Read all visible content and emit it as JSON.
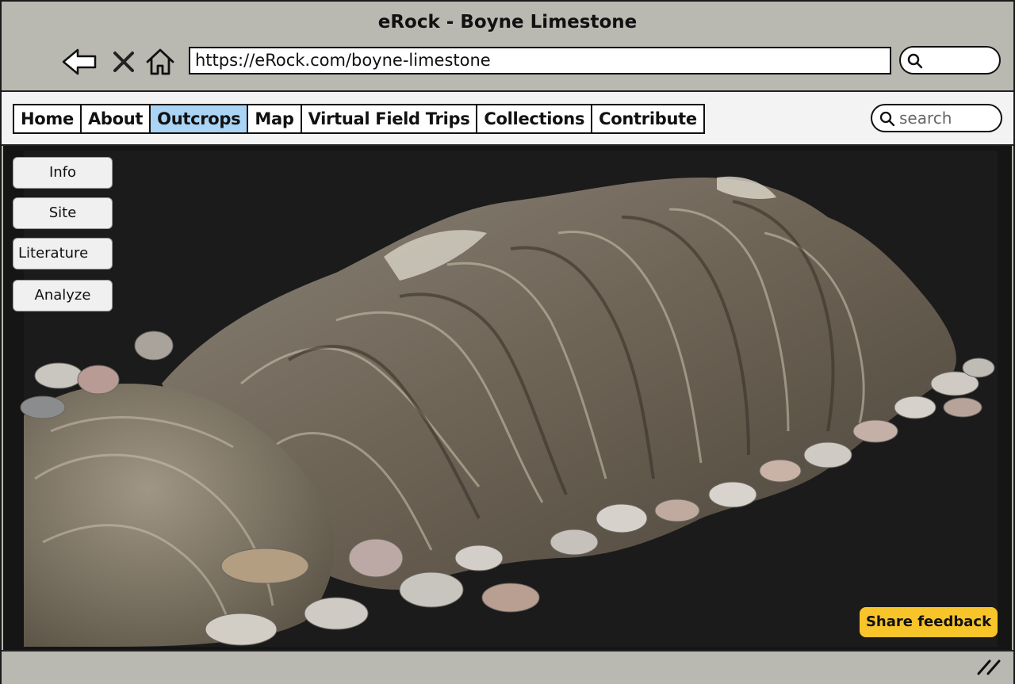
{
  "window": {
    "title": "eRock - Boyne Limestone"
  },
  "browser": {
    "url": "https://eRock.com/boyne-limestone",
    "icons": [
      "back-arrow-icon",
      "close-icon",
      "home-icon",
      "search-icon"
    ]
  },
  "nav": {
    "items": [
      {
        "label": "Home"
      },
      {
        "label": "About"
      },
      {
        "label": "Outcrops",
        "active": true
      },
      {
        "label": "Map"
      },
      {
        "label": "Virtual Field Trips"
      },
      {
        "label": "Collections"
      },
      {
        "label": "Contribute"
      }
    ],
    "active_color": "#a9d4f5"
  },
  "search": {
    "placeholder": "search"
  },
  "sidebar": {
    "buttons": [
      {
        "label": "Info"
      },
      {
        "label": "Site"
      },
      {
        "label": "Literature"
      },
      {
        "label": "Analyze"
      }
    ]
  },
  "viewer": {
    "content": "3d-outcrop-model",
    "background": "#151515"
  },
  "feedback": {
    "label": "Share feedback",
    "color": "#f7c42a"
  }
}
